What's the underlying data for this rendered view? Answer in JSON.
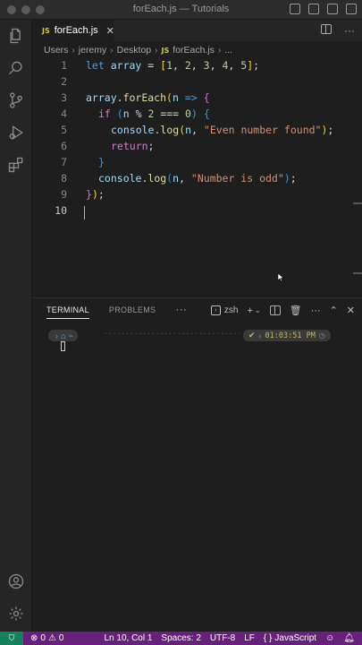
{
  "window": {
    "title": "forEach.js — Tutorials"
  },
  "tab": {
    "badge": "JS",
    "label": "forEach.js",
    "close": "✕"
  },
  "breadcrumb": {
    "parts": [
      "Users",
      "jeremy",
      "Desktop"
    ],
    "file_badge": "JS",
    "file": "forEach.js",
    "tail": "..."
  },
  "editor": {
    "line_numbers": [
      "1",
      "2",
      "3",
      "4",
      "5",
      "6",
      "7",
      "8",
      "9",
      "10"
    ],
    "active_line": 10,
    "code": {
      "l1_let": "let",
      "l1_name": "array",
      "l1_eq": " = ",
      "l1_open": "[",
      "l1_n1": "1",
      "l1_n2": "2",
      "l1_n3": "3",
      "l1_n4": "4",
      "l1_n5": "5",
      "l1_close": "]",
      "l1_end": ";",
      "l3_obj": "array",
      "l3_dot": ".",
      "l3_fn": "forEach",
      "l3_paren": "(",
      "l3_param": "n",
      "l3_arrow": " => ",
      "l3_brace": "{",
      "l4_if": "if",
      "l4_open": "(",
      "l4_expr1": "n",
      "l4_op": " % ",
      "l4_two": "2",
      "l4_eq": " === ",
      "l4_zero": "0",
      "l4_close": ")",
      "l4_brace": "{",
      "l5_console": "console",
      "l5_log": "log",
      "l5_open": "(",
      "l5_arg": "n",
      "l5_str": "\"Even number found\"",
      "l5_close": ")",
      "l5_semi": ";",
      "l6_return": "return",
      "l6_semi": ";",
      "l7_brace": "}",
      "l8_console": "console",
      "l8_log": "log",
      "l8_open": "(",
      "l8_arg": "n",
      "l8_str": "\"Number is odd\"",
      "l8_close": ")",
      "l8_semi": ";",
      "l9_brace": "}",
      "l9_paren": ")",
      "l9_semi": ";"
    }
  },
  "panel": {
    "tabs": [
      {
        "label": "TERMINAL",
        "active": true
      },
      {
        "label": "PROBLEMS",
        "active": false
      }
    ],
    "more": "···",
    "shell": "zsh",
    "terminal": {
      "home": "~",
      "check": "✔",
      "time": "01:03:51 PM",
      "dots": "·····························································"
    }
  },
  "statusbar": {
    "errors": "0",
    "warnings": "0",
    "position": "Ln 10, Col 1",
    "spaces": "Spaces: 2",
    "encoding": "UTF-8",
    "eol": "LF",
    "language_prefix": "{ }",
    "language": "JavaScript"
  },
  "colors": {
    "status_bar": "#68217a",
    "keyword": "#c586c0",
    "function": "#dcdcaa",
    "string": "#ce9178",
    "number": "#b5cea8"
  },
  "icons": {
    "activity": [
      "files-icon",
      "search-icon",
      "source-control-icon",
      "run-debug-icon",
      "extensions-icon",
      "account-icon",
      "settings-gear-icon"
    ]
  }
}
